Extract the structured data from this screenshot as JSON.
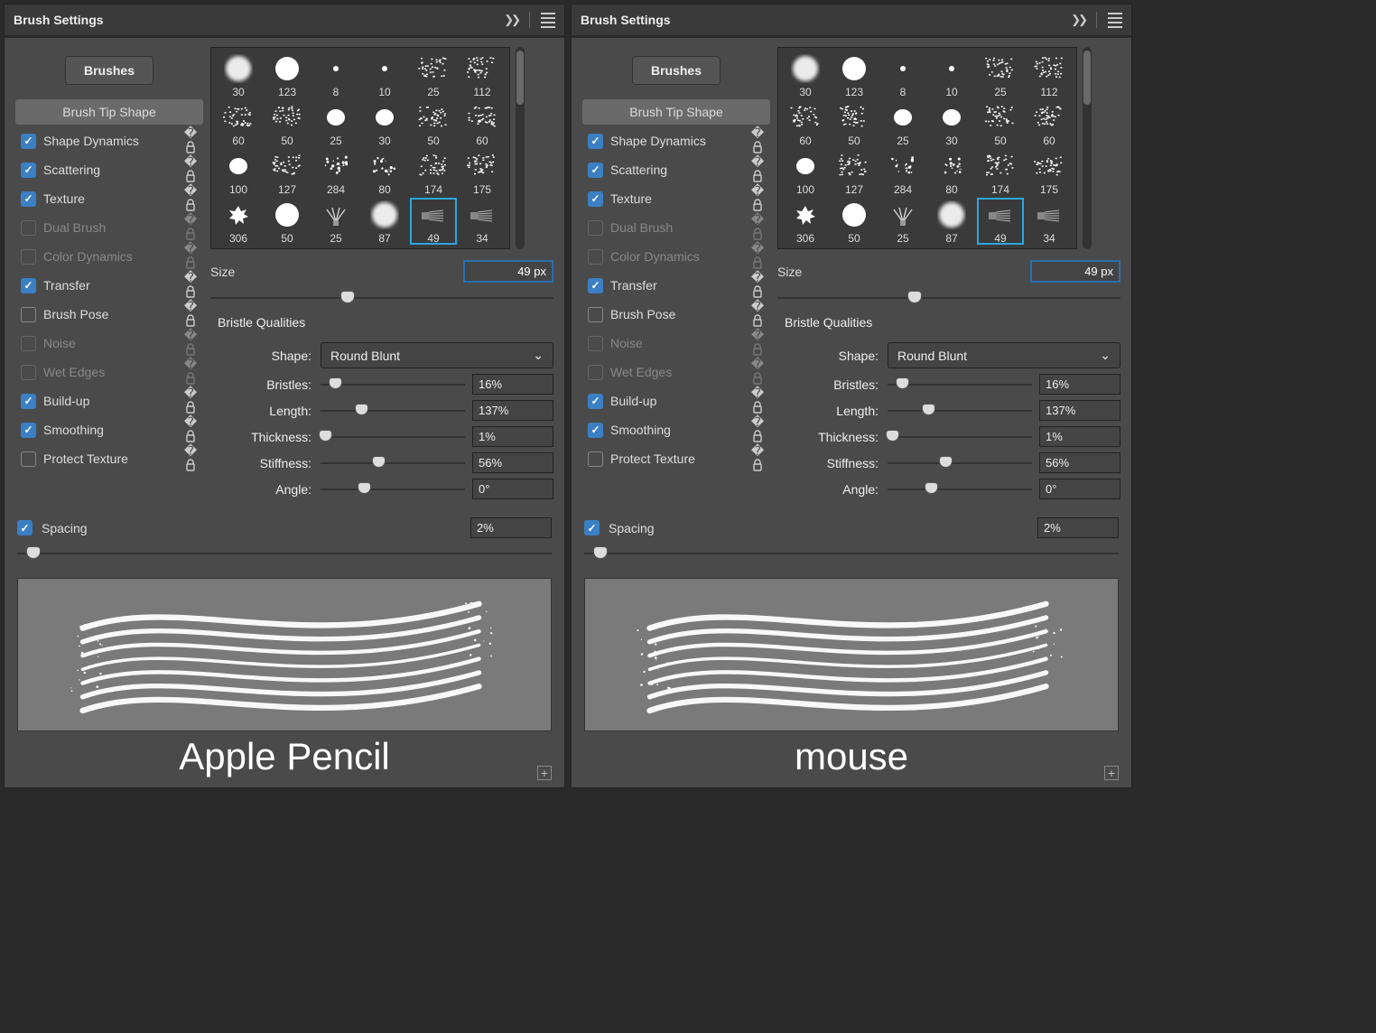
{
  "header": {
    "title": "Brush Settings"
  },
  "brushes_button": "Brushes",
  "tip_shape_label": "Brush Tip Shape",
  "options": [
    {
      "label": "Shape Dynamics",
      "checked": true,
      "enabled": true
    },
    {
      "label": "Scattering",
      "checked": true,
      "enabled": true
    },
    {
      "label": "Texture",
      "checked": true,
      "enabled": true
    },
    {
      "label": "Dual Brush",
      "checked": false,
      "enabled": false
    },
    {
      "label": "Color Dynamics",
      "checked": false,
      "enabled": false
    },
    {
      "label": "Transfer",
      "checked": true,
      "enabled": true
    },
    {
      "label": "Brush Pose",
      "checked": false,
      "enabled": true
    },
    {
      "label": "Noise",
      "checked": false,
      "enabled": false
    },
    {
      "label": "Wet Edges",
      "checked": false,
      "enabled": false
    },
    {
      "label": "Build-up",
      "checked": true,
      "enabled": true
    },
    {
      "label": "Smoothing",
      "checked": true,
      "enabled": true
    },
    {
      "label": "Protect Texture",
      "checked": false,
      "enabled": true
    }
  ],
  "thumbs": [
    {
      "n": "30",
      "t": "soft"
    },
    {
      "n": "123",
      "t": "hard"
    },
    {
      "n": "8",
      "t": "dot"
    },
    {
      "n": "10",
      "t": "dot"
    },
    {
      "n": "25",
      "t": "tex"
    },
    {
      "n": "112",
      "t": "tex"
    },
    {
      "n": "60",
      "t": "tex"
    },
    {
      "n": "50",
      "t": "tex"
    },
    {
      "n": "25",
      "t": "blob"
    },
    {
      "n": "30",
      "t": "blob"
    },
    {
      "n": "50",
      "t": "tex"
    },
    {
      "n": "60",
      "t": "tex"
    },
    {
      "n": "100",
      "t": "blob"
    },
    {
      "n": "127",
      "t": "tex"
    },
    {
      "n": "284",
      "t": "dots"
    },
    {
      "n": "80",
      "t": "dots"
    },
    {
      "n": "174",
      "t": "tex"
    },
    {
      "n": "175",
      "t": "tex"
    },
    {
      "n": "306",
      "t": "splat"
    },
    {
      "n": "50",
      "t": "hard"
    },
    {
      "n": "25",
      "t": "fan"
    },
    {
      "n": "87",
      "t": "soft"
    },
    {
      "n": "49",
      "t": "bristle",
      "sel": true
    },
    {
      "n": "34",
      "t": "bristle"
    }
  ],
  "size": {
    "label": "Size",
    "value": "49 px",
    "pos": 40
  },
  "bristle": {
    "group": "Bristle Qualities",
    "shape_label": "Shape:",
    "shape_value": "Round Blunt",
    "rows": [
      {
        "label": "Bristles:",
        "value": "16%",
        "pos": 10
      },
      {
        "label": "Length:",
        "value": "137%",
        "pos": 28
      },
      {
        "label": "Thickness:",
        "value": "1%",
        "pos": 3
      },
      {
        "label": "Stiffness:",
        "value": "56%",
        "pos": 40
      },
      {
        "label": "Angle:",
        "value": "0°",
        "pos": 30
      }
    ]
  },
  "spacing": {
    "label": "Spacing",
    "checked": true,
    "value": "2%",
    "pos": 3
  },
  "captions": [
    "Apple Pencil",
    "mouse"
  ]
}
